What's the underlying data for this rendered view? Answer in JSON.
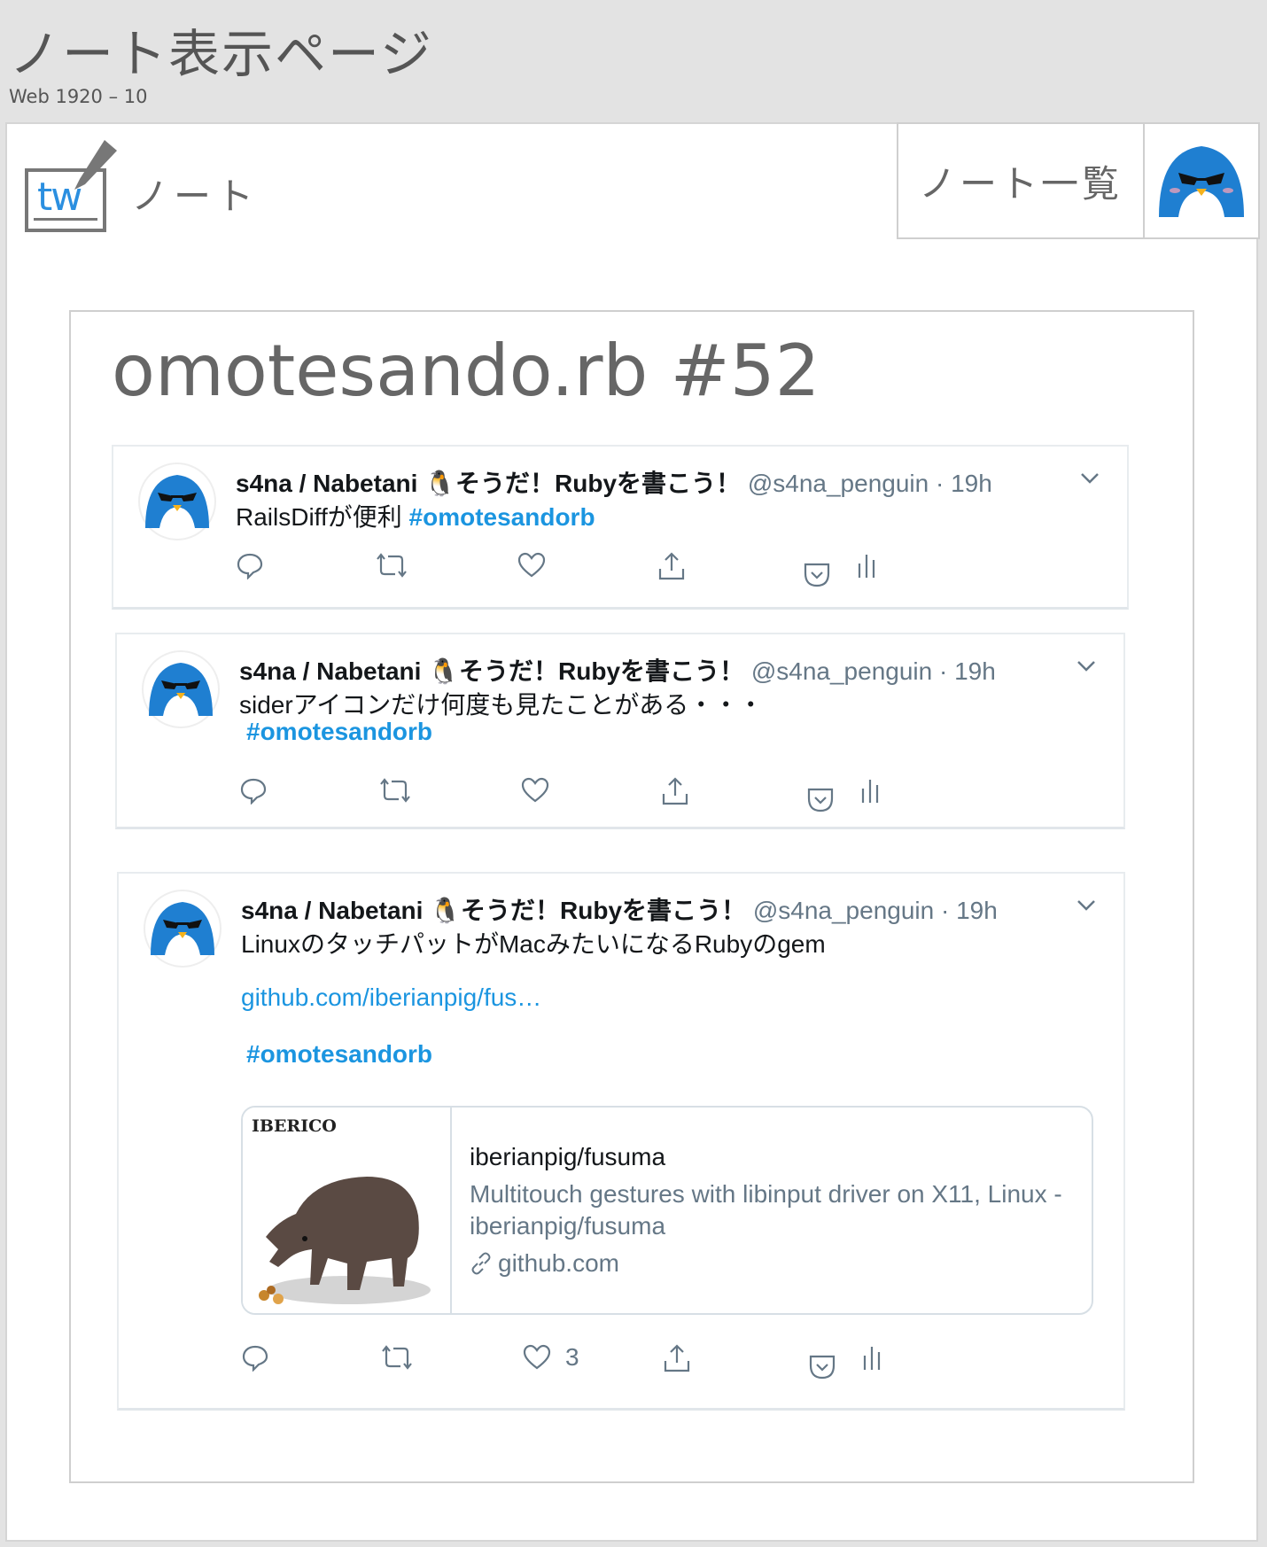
{
  "artboard": {
    "title": "ノート表示ページ",
    "subtitle": "Web 1920 – 10"
  },
  "header": {
    "app_name": "ノート",
    "nav_list_label": "ノート一覧",
    "logo_text": "tw"
  },
  "note": {
    "title": "omotesando.rb #52",
    "tweets": [
      {
        "name": "s4na / Nabetani 🐧そうだ！Rubyを書こう！",
        "handle": "@s4na_penguin",
        "time": "19h",
        "text": "RailsDiffが便利",
        "hashtag": "#omotesandorb"
      },
      {
        "name": "s4na / Nabetani 🐧そうだ！Rubyを書こう！",
        "handle": "@s4na_penguin",
        "time": "19h",
        "text": "siderアイコンだけ何度も見たことがある・・・",
        "hashtag": "#omotesandorb"
      },
      {
        "name": "s4na / Nabetani 🐧そうだ！Rubyを書こう！",
        "handle": "@s4na_penguin",
        "time": "19h",
        "text": "LinuxのタッチパットがMacみたいになるRubyのgem",
        "link": "github.com/iberianpig/fus…",
        "hashtag": "#omotesandorb",
        "like_count": "3",
        "card": {
          "brand": "IBERICO",
          "title": "iberianpig/fusuma",
          "description": "Multitouch gestures with libinput driver on X11, Linux - iberianpig/fusuma",
          "domain": "github.com"
        }
      }
    ]
  },
  "colors": {
    "link": "#1b95e0",
    "penguin": "#1f7fd1",
    "meta": "#657786"
  },
  "icons": [
    "pencil-icon",
    "penguin-avatar",
    "reply-icon",
    "retweet-icon",
    "like-icon",
    "share-icon",
    "pocket-icon",
    "analytics-icon",
    "chevron-down-icon",
    "link-icon"
  ]
}
